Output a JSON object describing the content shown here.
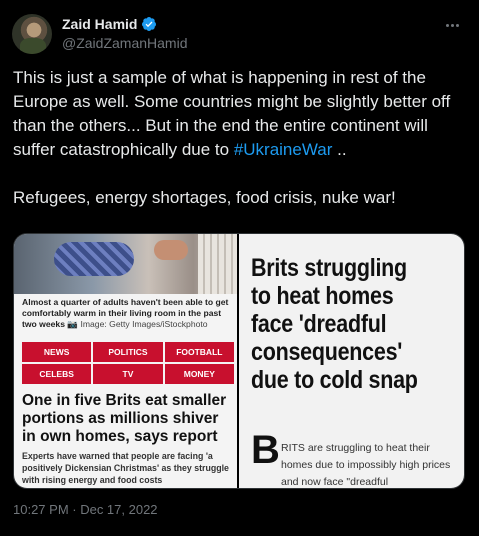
{
  "author": {
    "display_name": "Zaid Hamid",
    "handle": "@ZaidZamanHamid",
    "verified": true
  },
  "tweet": {
    "line1": "This is just a sample of what is happening in rest of the Europe as well. Some countries might be slightly better off than the others... But in the end the entire continent will suffer catastrophically due to ",
    "hashtag": "#UkraineWar",
    "after_hashtag": " ..",
    "line2": "Refugees, energy shortages, food crisis, nuke war!"
  },
  "media": {
    "left": {
      "caption": "Almost a quarter of adults haven't been able to get comfortably warm in their living room in the past two weeks",
      "credit": "Image: Getty Images/iStockphoto",
      "nav": [
        "NEWS",
        "POLITICS",
        "FOOTBALL",
        "CELEBS",
        "TV",
        "MONEY"
      ],
      "nav_color": "#c8102e",
      "headline": "One in five Brits eat smaller portions as millions shiver in own homes, says report",
      "standfirst": "Experts have warned that people are facing 'a positively Dickensian Christmas' as they struggle with rising energy and food costs"
    },
    "right": {
      "headline": "Brits struggling to heat homes face 'dreadful consequences' due to cold snap",
      "dropcap": "B",
      "body": "RITS are struggling to heat their homes due to impossibly high prices and now face \"dreadful"
    }
  },
  "footer": {
    "timestamp": "10:27 PM · Dec 17, 2022"
  },
  "icons": {
    "verified": "verified-badge-icon",
    "more": "more-options-icon"
  },
  "colors": {
    "background": "#000000",
    "text": "#e7e9ea",
    "secondary": "#71767b",
    "link": "#1d9bf0"
  }
}
